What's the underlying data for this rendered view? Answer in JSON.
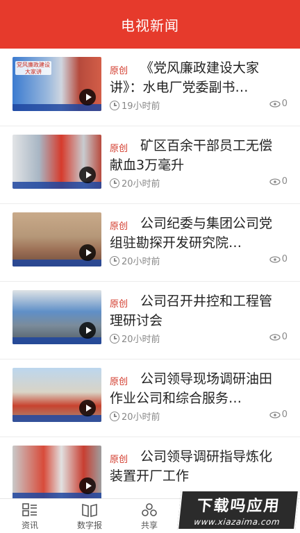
{
  "header": {
    "title": "电视新闻"
  },
  "news": [
    {
      "tag": "原创",
      "title": "《党风廉政建设大家讲》：水电厂党委副书…",
      "time": "19小时前",
      "views": "0",
      "thumb_caption": "党风廉政建设 大家讲"
    },
    {
      "tag": "原创",
      "title": "矿区百余干部员工无偿献血3万毫升",
      "time": "20小时前",
      "views": "0"
    },
    {
      "tag": "原创",
      "title": "公司纪委与集团公司党组驻勘探开发研究院…",
      "time": "20小时前",
      "views": "0"
    },
    {
      "tag": "原创",
      "title": "公司召开井控和工程管理研讨会",
      "time": "20小时前",
      "views": "0"
    },
    {
      "tag": "原创",
      "title": "公司领导现场调研油田作业公司和综合服务…",
      "time": "20小时前",
      "views": "0"
    },
    {
      "tag": "原创",
      "title": "公司领导调研指导炼化装置开厂工作",
      "time": "",
      "views": ""
    }
  ],
  "tabbar": {
    "items": [
      {
        "label": "资讯",
        "icon": "news-list-icon"
      },
      {
        "label": "数字报",
        "icon": "newspaper-icon"
      },
      {
        "label": "共享",
        "icon": "share-circles-icon"
      },
      {
        "label": "",
        "icon": ""
      },
      {
        "label": "",
        "icon": ""
      }
    ]
  },
  "watermark": {
    "title": "下载吗应用",
    "url": "www.xiazaima.com"
  },
  "colors": {
    "brand": "#e63a2c",
    "tag": "#d2392a",
    "meta": "#888888"
  }
}
